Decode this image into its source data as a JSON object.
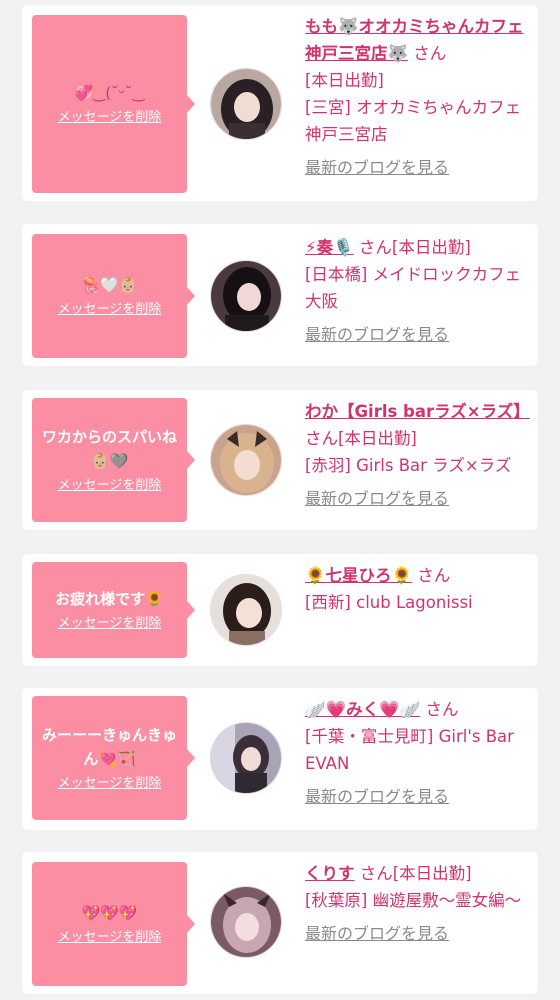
{
  "colors": {
    "bubble": "#fb8ea2",
    "accent": "#d2336e",
    "link_gray": "#8a8a8a",
    "background": "#f2f2f4",
    "card": "#ffffff"
  },
  "cards": [
    {
      "message_text": "",
      "message_emoji": "💞‿(˘ᵕ˘‿",
      "delete_label": "メッセージを削除",
      "name": "もも🐺オオカミちゃんカフェ神戸三宮店🐺",
      "honorific": "さん",
      "status": "[本日出勤]",
      "shop": "[三宮] オオカミちゃんカフェ神戸三宮店",
      "blog_label": "最新のブログを見る"
    },
    {
      "message_text": "",
      "message_emoji": "🪼🤍👶🏼",
      "delete_label": "メッセージを削除",
      "name": "⚡奏🎙️",
      "honorific": "さん",
      "status": "[本日出勤]",
      "shop": "[日本橋] メイドロックカフェ 大阪",
      "blog_label": "最新のブログを見る"
    },
    {
      "message_text": "ワカからのスパいね",
      "message_emoji": "👶🏼🩶",
      "delete_label": "メッセージを削除",
      "name": "わか【Girls barラズ×ラズ】",
      "honorific": "さん",
      "status": "[本日出勤]",
      "shop": "[赤羽] Girls Bar ラズ×ラズ",
      "blog_label": "最新のブログを見る"
    },
    {
      "message_text": "お疲れ様です",
      "message_emoji": "🌻",
      "delete_label": "メッセージを削除",
      "name": "🌻七星ひろ🌻",
      "honorific": "さん",
      "status": "",
      "shop": "[西新] club Lagonissi",
      "blog_label": ""
    },
    {
      "message_text": "みーーーきゅんきゅん",
      "message_emoji": "💘🏹",
      "delete_label": "メッセージを削除",
      "name": "🪽💗みく💗🪽",
      "honorific": "さん",
      "status": "",
      "shop": "[千葉・富士見町] Girl's Bar EVAN",
      "blog_label": "最新のブログを見る"
    },
    {
      "message_text": "",
      "message_emoji": "💖💖💖",
      "delete_label": "メッセージを削除",
      "name": "くりす",
      "honorific": "さん",
      "status": "[本日出勤]",
      "shop": "[秋葉原] 幽遊屋敷〜霊女編〜",
      "blog_label": "最新のブログを見る"
    }
  ]
}
